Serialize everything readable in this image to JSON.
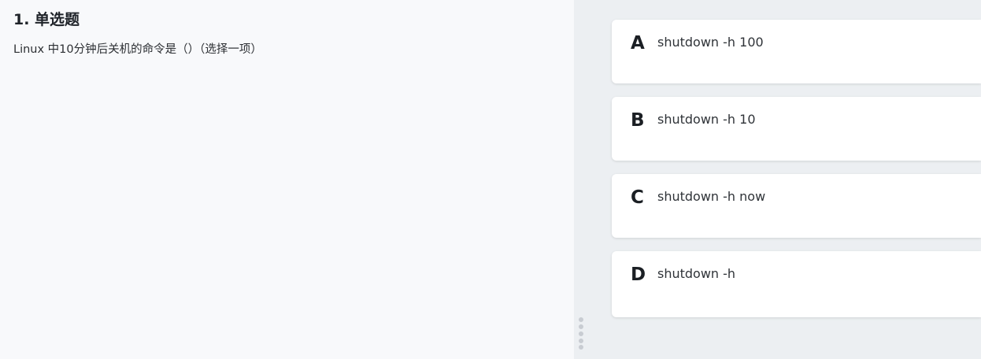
{
  "question": {
    "title": "1. 单选题",
    "text": "Linux 中10分钟后关机的命令是（）（选择一项）"
  },
  "options": [
    {
      "letter": "A",
      "text": "shutdown -h 100"
    },
    {
      "letter": "B",
      "text": "shutdown -h 10"
    },
    {
      "letter": "C",
      "text": "shutdown -h now"
    },
    {
      "letter": "D",
      "text": "shutdown -h"
    }
  ],
  "icons": {
    "drag_handle": "vertical-dots-drag-handle-icon"
  }
}
